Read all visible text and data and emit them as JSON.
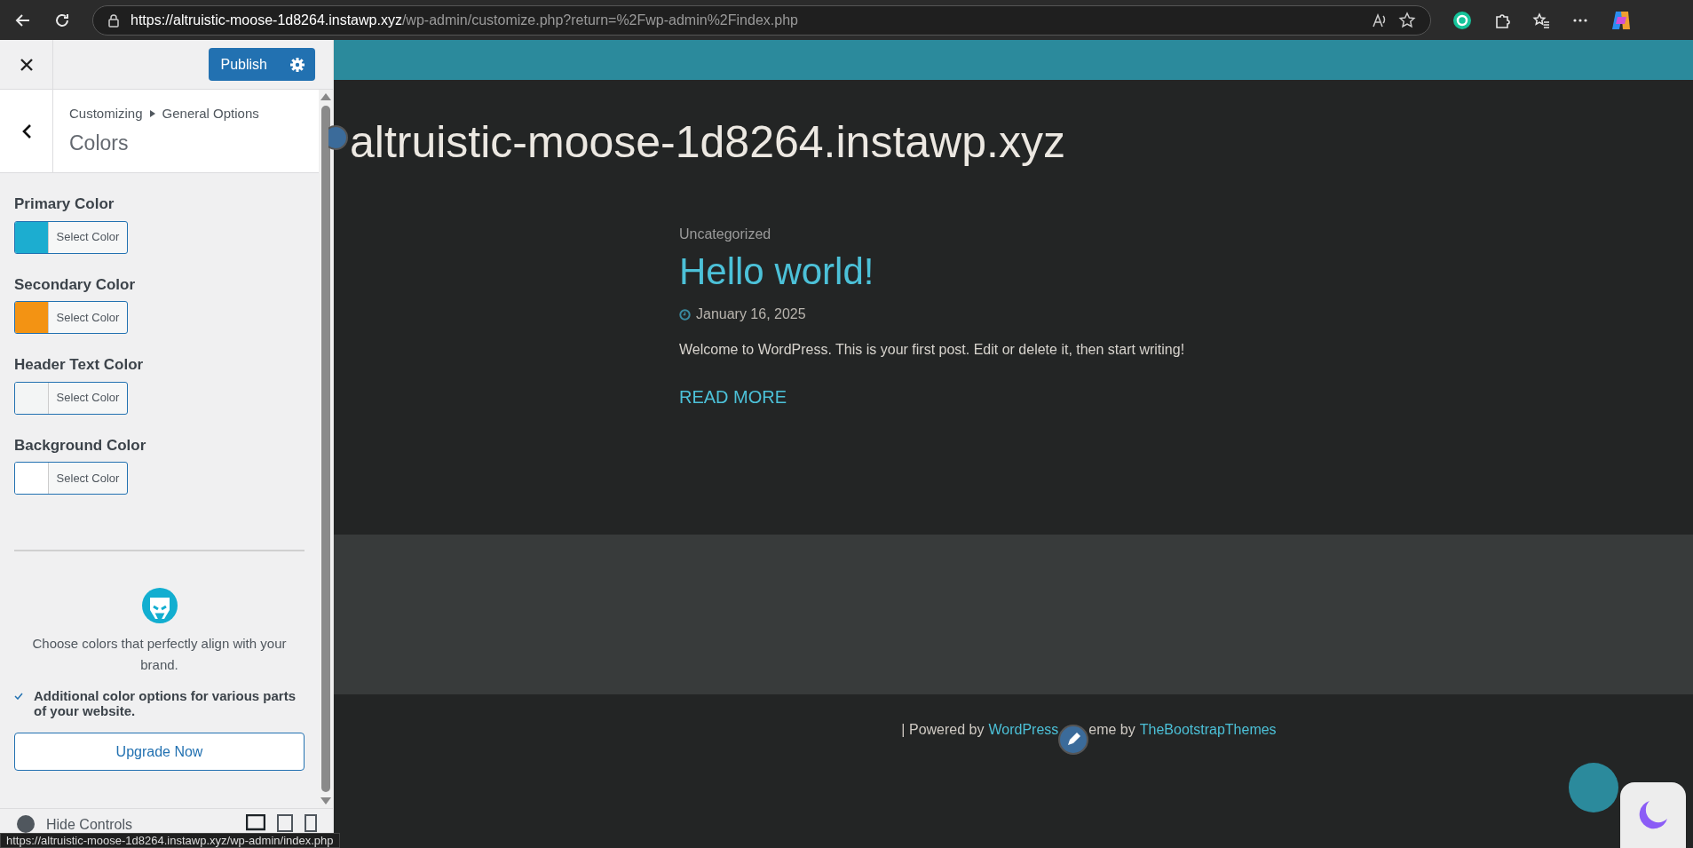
{
  "browser": {
    "url_host": "https://altruistic-moose-1d8264.instawp.xyz",
    "url_path": "/wp-admin/customize.php?return=%2Fwp-admin%2Findex.php"
  },
  "panel": {
    "publish": "Publish",
    "breadcrumb": [
      "Customizing",
      "General Options"
    ],
    "title": "Colors",
    "controls": [
      {
        "label": "Primary Color",
        "button": "Select Color",
        "color": "#1cadd0"
      },
      {
        "label": "Secondary Color",
        "button": "Select Color",
        "color": "#f39313"
      },
      {
        "label": "Header Text Color",
        "button": "Select Color",
        "color": "#f3f5f5"
      },
      {
        "label": "Background Color",
        "button": "Select Color",
        "color": "#ffffff"
      }
    ],
    "promo": {
      "text": "Choose colors that perfectly align with your brand.",
      "features": [
        "Additional color options for various parts of your website."
      ],
      "button": "Upgrade Now"
    },
    "footer": {
      "hide": "Hide Controls"
    }
  },
  "preview": {
    "site_title": "altruistic-moose-1d8264.instawp.xyz",
    "post": {
      "category": "Uncategorized",
      "title": "Hello world!",
      "date": "January 16, 2025",
      "excerpt": "Welcome to WordPress. This is your first post. Edit or delete it, then start writing!",
      "more": "READ MORE"
    },
    "credit": {
      "prefix": "| Powered by",
      "link1": "WordPress",
      "middle": "eme by",
      "link2": "TheBootstrapThemes"
    }
  },
  "status_url": "https://altruistic-moose-1d8264.instawp.xyz/wp-admin/index.php"
}
